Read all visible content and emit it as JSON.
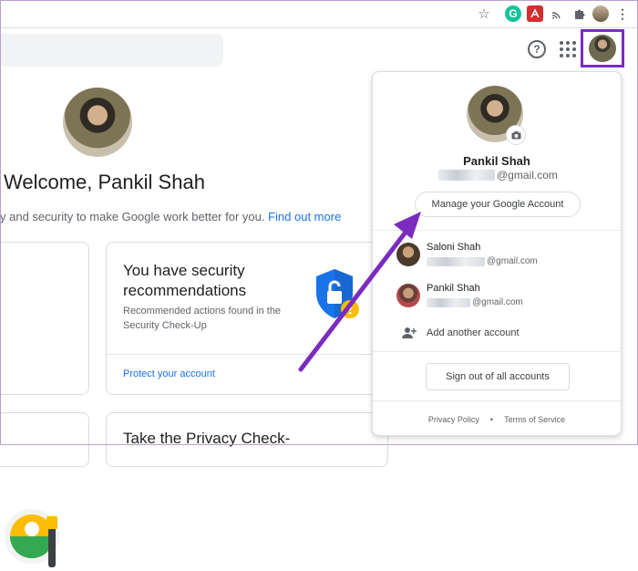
{
  "browser": {
    "icons": [
      "star-icon",
      "grammarly-icon",
      "adobe-icon",
      "cast-icon",
      "puzzle-icon",
      "avatar",
      "kebab-icon"
    ],
    "grammarly_letter": "G"
  },
  "header": {
    "help_glyph": "?",
    "help_icon": "help-icon",
    "apps_icon": "apps-grid-icon"
  },
  "main": {
    "welcome": "Welcome, Pankil Shah",
    "subtitle_text": "y and security to make Google work better for you.",
    "subtitle_link": "Find out more",
    "security_card": {
      "title": "You have security recommendations",
      "description": "Recommended actions found in the Security Check-Up",
      "link": "Protect your account"
    },
    "privacy_card": {
      "title": "Take the Privacy Check-"
    }
  },
  "popup": {
    "name": "Pankil Shah",
    "email_suffix": "@gmail.com",
    "manage_label": "Manage your Google Account",
    "accounts": [
      {
        "name": "Saloni Shah",
        "email_suffix": "@gmail.com"
      },
      {
        "name": "Pankil Shah",
        "email_suffix": "@gmail.com"
      }
    ],
    "add_account": "Add another account",
    "sign_out": "Sign out of all accounts",
    "footer": {
      "privacy": "Privacy Policy",
      "separator": "•",
      "terms": "Terms of Service"
    }
  },
  "colors": {
    "highlight_border": "#7b2cbf",
    "link": "#1a73e8",
    "arrow": "#7b2cbf"
  }
}
